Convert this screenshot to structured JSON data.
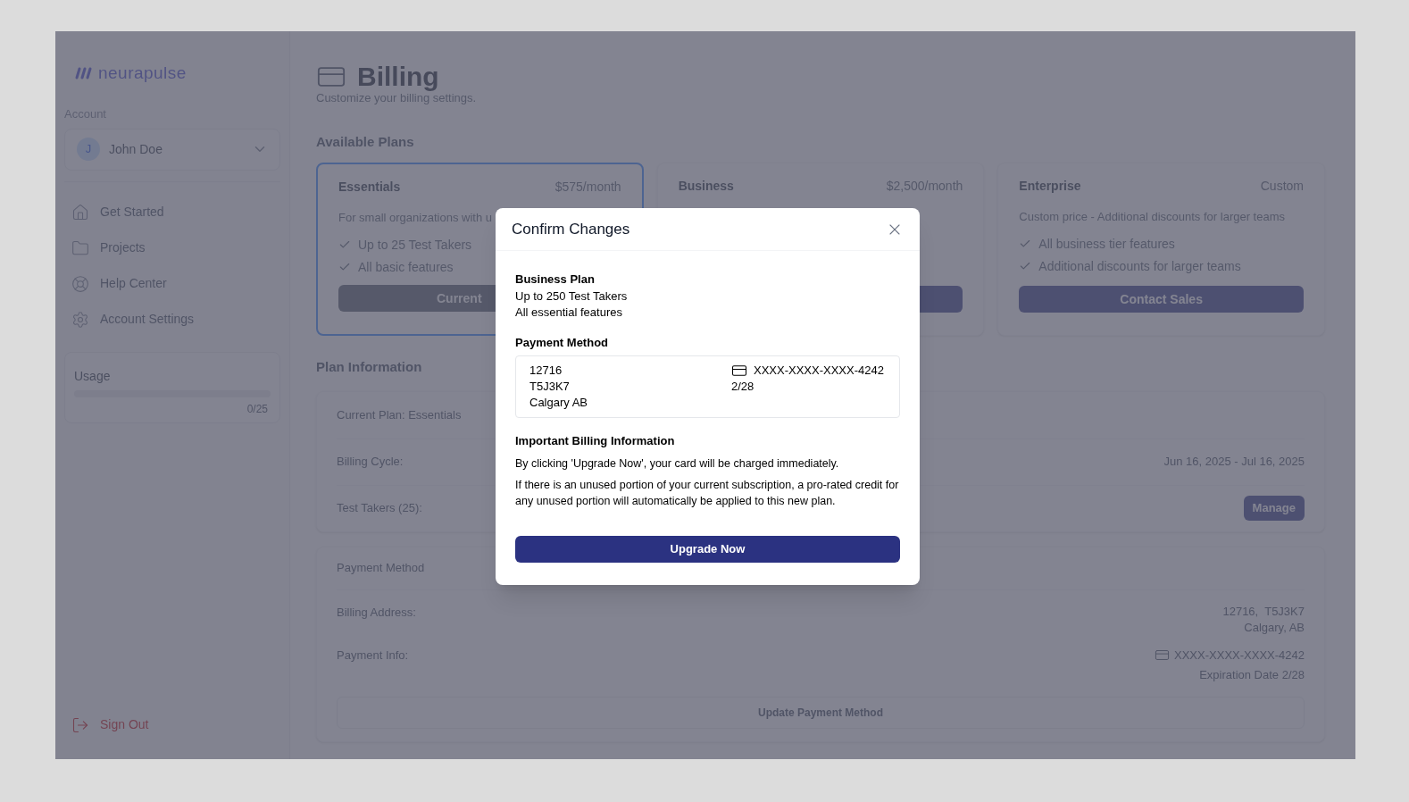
{
  "sidebar": {
    "logo": "neurapulse",
    "account_label": "Account",
    "account": {
      "initial": "J",
      "name": "John Doe"
    },
    "nav": [
      {
        "label": "Get Started"
      },
      {
        "label": "Projects"
      },
      {
        "label": "Help Center"
      },
      {
        "label": "Account Settings"
      }
    ],
    "usage": {
      "label": "Usage",
      "level": 0,
      "count": "0/25"
    },
    "sign_out": "Sign Out"
  },
  "page": {
    "title": "Billing",
    "subtitle": "Customize your billing settings."
  },
  "plans": {
    "heading": "Available Plans",
    "items": [
      {
        "name": "Essentials",
        "price": "$575/month",
        "description": "For small organizations with u",
        "features": [
          "Up to 25 Test Takers",
          "All basic features"
        ],
        "button": {
          "label": "Current",
          "disabled": true
        },
        "selected": true
      },
      {
        "name": "Business",
        "price": "$2,500/month",
        "selected": false
      },
      {
        "name": "Enterprise",
        "price": "Custom",
        "description": "Custom price - Additional discounts for larger teams",
        "features": [
          "All business tier features",
          "Additional discounts for larger teams"
        ],
        "button": {
          "label": "Contact Sales",
          "disabled": false
        },
        "selected": false
      }
    ]
  },
  "plan_information": {
    "heading": "Plan Information",
    "rows": [
      {
        "label": "Current Plan: Essentials"
      },
      {
        "label": "Billing Cycle:",
        "value": "Jun 16, 2025 - Jul 16, 2025"
      },
      {
        "label": "Test Takers (25):",
        "button": "Manage"
      }
    ]
  },
  "payment": {
    "heading": "Payment Method",
    "address_label": "Billing Address:",
    "address": [
      "12716,  T5J3K7",
      "Calgary, AB"
    ],
    "info_label": "Payment Info:",
    "card": "XXXX-XXXX-XXXX-4242",
    "expiry": "Expiration Date 2/28",
    "button": "Update Payment Method"
  },
  "modal": {
    "title": "Confirm Changes",
    "plan": {
      "name": "Business Plan",
      "lines": [
        "Up to 250 Test Takers",
        "All essential features"
      ]
    },
    "payment": {
      "heading": "Payment Method",
      "address": [
        "12716",
        "T5J3K7",
        "Calgary AB"
      ],
      "card": "XXXX-XXXX-XXXX-4242",
      "expiry": "2/28"
    },
    "info": {
      "heading": "Important Billing Information",
      "paragraphs": [
        "By clicking 'Upgrade Now', your card will be charged immediately.",
        "If there is an unused portion of your current subscription, a pro-rated credit for any unused portion will automatically be applied to this new plan."
      ]
    },
    "button": "Upgrade Now"
  }
}
